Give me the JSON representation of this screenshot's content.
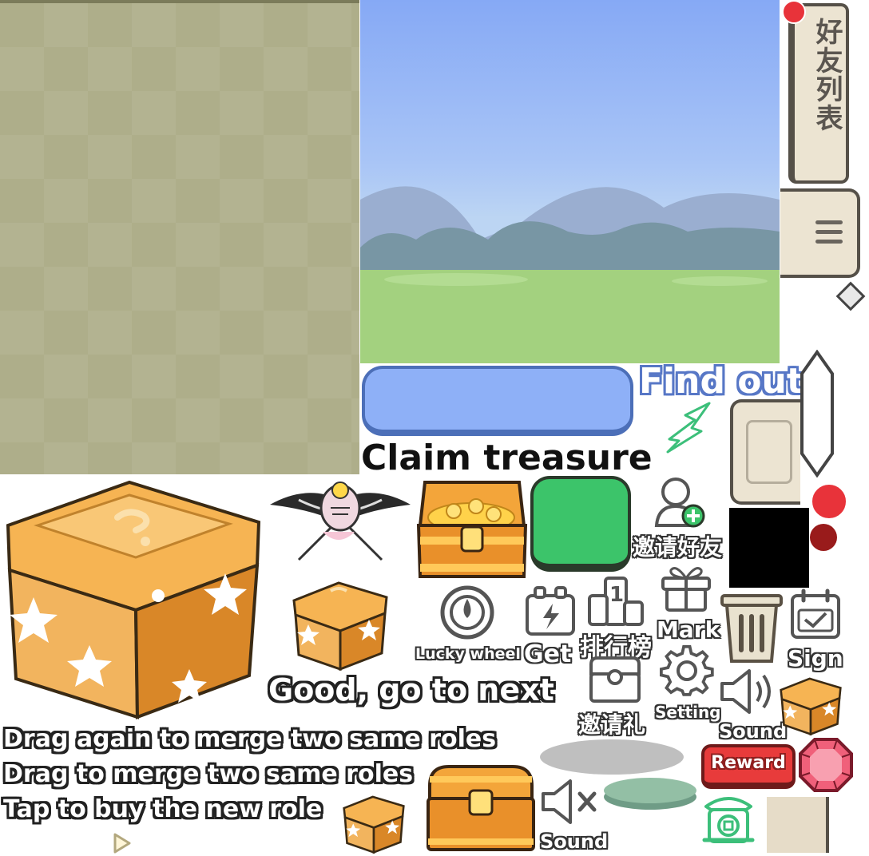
{
  "friends_tab": {
    "label": "好友列表"
  },
  "find_out": {
    "label": "Find out"
  },
  "claim_treasure": {
    "label": "Claim treasure"
  },
  "invite_friends": {
    "label": "邀请好友"
  },
  "lucky_wheel": {
    "label": "Lucky wheel"
  },
  "get": {
    "label": "Get"
  },
  "ranking": {
    "label": "排行榜",
    "rank_number": "1"
  },
  "mark": {
    "label": "Mark"
  },
  "sign": {
    "label": "Sign"
  },
  "invite_gift": {
    "label": "邀请礼"
  },
  "setting": {
    "label": "Setting"
  },
  "sound_on": {
    "label": "Sound"
  },
  "sound_off": {
    "label": "Sound"
  },
  "reward": {
    "label": "Reward"
  },
  "messages": {
    "good_next": "Good, go to next",
    "drag_again": "Drag again to merge two same roles",
    "drag_merge": "Drag to merge two same roles",
    "tap_buy": "Tap to buy the new role"
  },
  "colors": {
    "olive_bg": "#aeae8a",
    "sky_blue": "#86a9f5",
    "grass": "#a3d17f",
    "blue_pill": "#8eb0f7",
    "green_button": "#3cc46a",
    "reward_red": "#e83b3b",
    "gold": "#f0a630",
    "panel_cream": "#ece4d2"
  }
}
